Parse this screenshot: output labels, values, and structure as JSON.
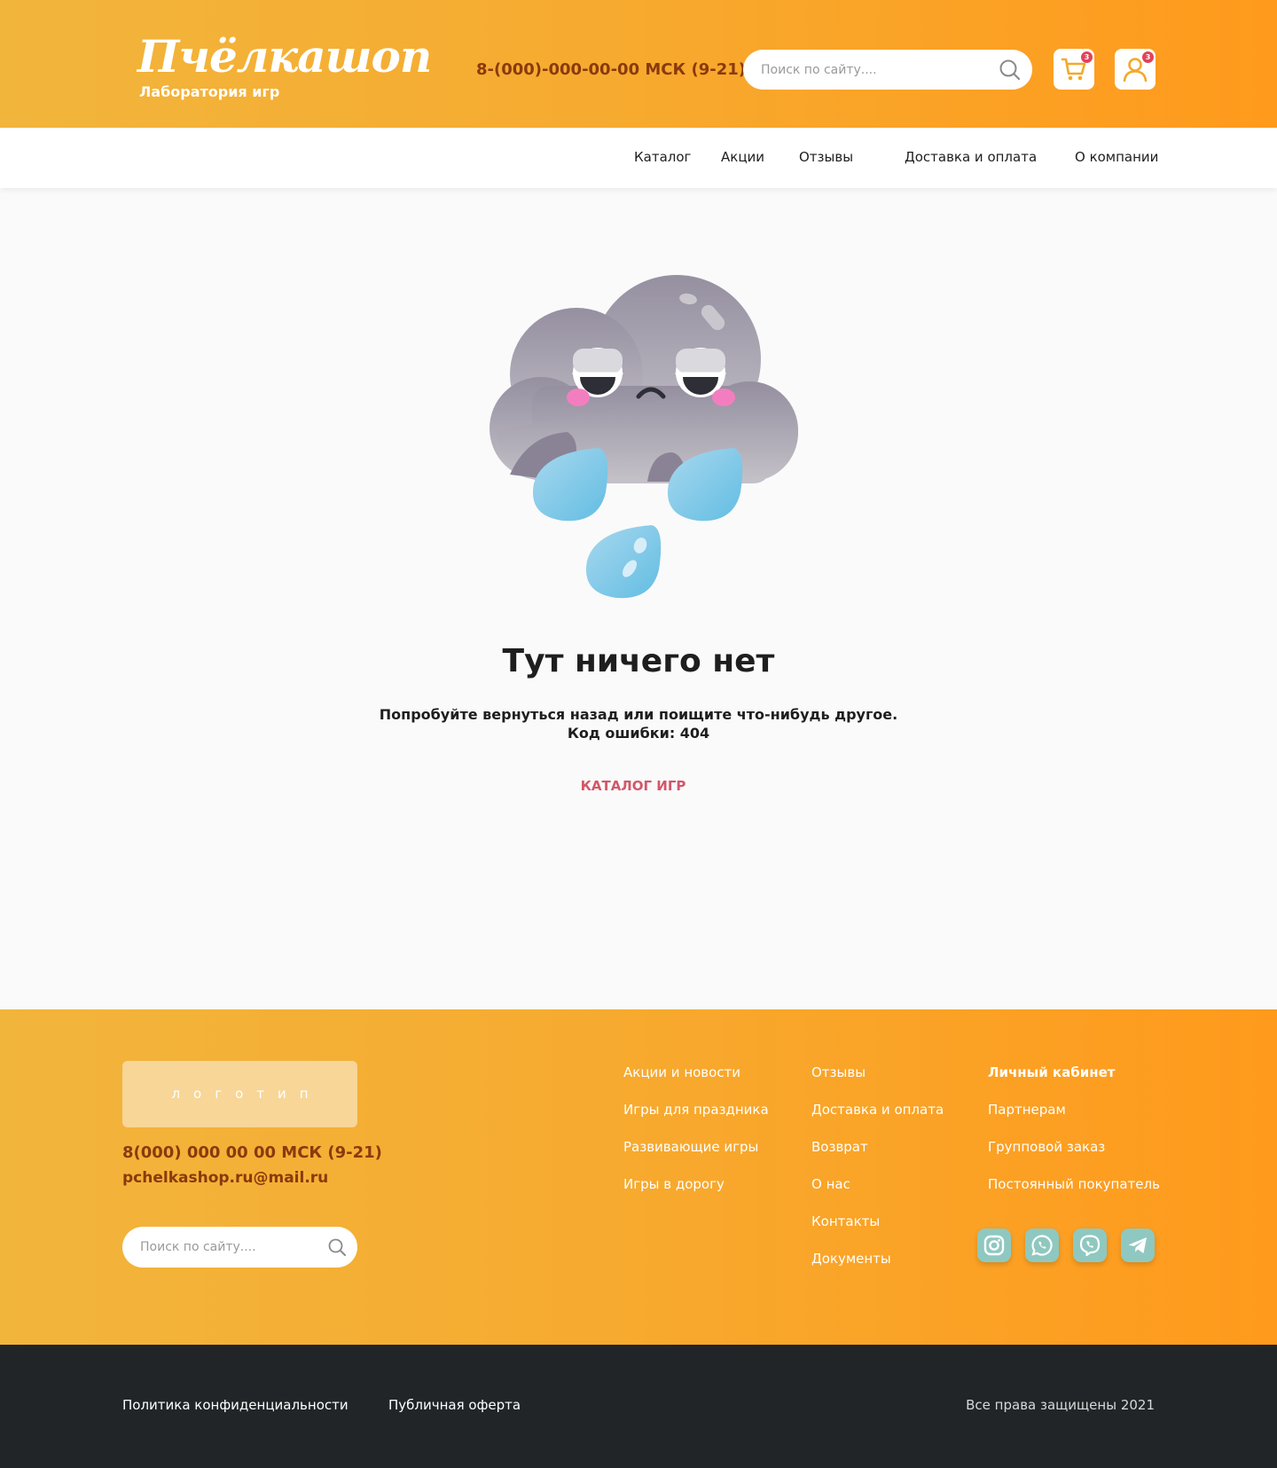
{
  "header": {
    "logo_text": "Пчёлкашоп",
    "logo_subtitle": "Лаборатория игр",
    "phone": "8-(000)-000-00-00 МСК (9-21)",
    "search_placeholder": "Поиск по сайту....",
    "cart_count": "3",
    "user_count": "3"
  },
  "nav": {
    "items": [
      "Каталог",
      "Акции",
      "Отзывы",
      "Доставка и оплата",
      "О компании"
    ]
  },
  "error": {
    "title": "Тут ничего нет",
    "line1": "Попробуйте вернуться назад или поищите что-нибудь другое.",
    "line2": "Код ошибки: 404",
    "cta": "КАТАЛОГ ИГР"
  },
  "footer": {
    "logo_placeholder": "логотип",
    "phone": "8(000) 000 00 00 МСК (9-21)",
    "email": "pchelkashop.ru@mail.ru",
    "search_placeholder": "Поиск по сайту....",
    "col1": [
      "Акции и новости",
      "Игры для праздника",
      "Развивающие игры",
      "Игры в дорогу"
    ],
    "col2": [
      "Отзывы",
      "Доставка и оплата",
      "Возврат",
      "О нас",
      "Контакты",
      "Документы"
    ],
    "col3": [
      "Личный кабинет",
      "Партнерам",
      "Групповой заказ",
      "Постоянный покупатель"
    ],
    "social": [
      "instagram-icon",
      "whatsapp-icon",
      "viber-icon",
      "telegram-icon"
    ],
    "social_color": "#8fc8c0"
  },
  "bottom": {
    "privacy": "Политика конфиденциальности",
    "offer": "Публичная оферта",
    "copyright": "Все права защищены 2021"
  },
  "colors": {
    "orange_start": "#f2b53c",
    "orange_end": "#ff9a1c",
    "brown_text": "#8a3a0c",
    "accent_pink": "#d35768",
    "dark_bar": "#212528"
  }
}
